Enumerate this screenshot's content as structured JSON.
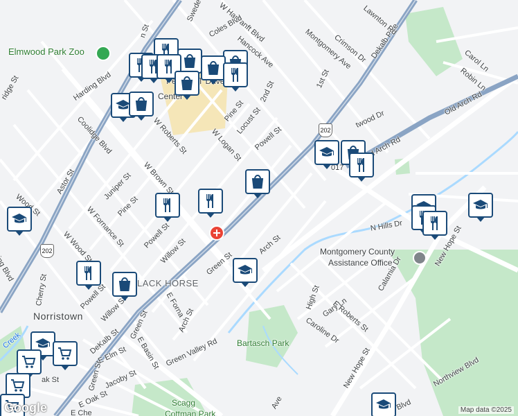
{
  "map": {
    "attribution": "Map data ©2025",
    "logo": "Google",
    "colors": {
      "background": "#f2f3f5",
      "park": "#c5e8c9",
      "water": "#aadaff",
      "highway": "#8aa4c4",
      "road": "#ffffff",
      "pin": "#1a4a78",
      "campus": "#f5e6b8"
    }
  },
  "labels": {
    "elmwood_zoo": "Elmwood Park Zoo",
    "penndot": "PennDOT Driver",
    "penndot2": "Center",
    "swede": "Swede Rd",
    "hartranft": "W Hartranft Blvd",
    "coles": "Coles Blvd",
    "hancock": "Hancock Ave",
    "montgomery_ave": "Montgomery Ave",
    "crimson": "Crimson Dr",
    "dekalb_pike": "Dekalb Pike",
    "lawnton": "Lawnton Rd",
    "carol": "Carol Ln",
    "robin": "Robin Ln",
    "old_arch": "Old Arch Rd",
    "old_arch2": "d Arch Rd",
    "first_st": "1st St",
    "second_st": "2nd St",
    "pine_st": "Pine St",
    "locust": "Locust St",
    "powell": "Powell St",
    "w_logan": "W Logan St",
    "w_roberts": "W Roberts St",
    "harding": "Harding Blvd",
    "coolidge": "Coolidge Blvd",
    "w_brown": "W Brown St",
    "astor": "Astor St",
    "juniper": "Juniper St",
    "pine2": "Pine St",
    "wood": "Wood St",
    "w_fornance": "W Fornance St",
    "powell2": "Powell St",
    "willow": "Willow St",
    "green": "Green St",
    "arch": "Arch St",
    "w_wood": "W Wood St",
    "black_horse": "LACK HORSE",
    "powell3": "Powell St",
    "willow2": "Willow St",
    "cherry": "Cherry St",
    "norristown": "Norristown",
    "dekalb": "DeKalb St",
    "e_fornance": "E Forna",
    "arch2": "Arch St",
    "green2": "Green St",
    "e_basin": "E Basin St",
    "green_valley": "Green Valley Rd",
    "e_elm": "E Elm St",
    "green3": "Green St",
    "jacoby": "Jacoby St",
    "e_oak": "E Oak St",
    "bartasch": "Bartasch Park",
    "montco1": "Montgomery County",
    "montco2": "Assistance Office",
    "n_hills": "N Hills Dr",
    "new_hope": "New Hope St",
    "new_hope2": "New Hope St",
    "calamia": "Calamia Dr",
    "high": "High St",
    "gary": "Gary Ln",
    "caroline": "Caroline Dr",
    "e_roberts": "E Roberts St",
    "northview": "Northview Blvd",
    "scagg": "Scagg",
    "cottman": "Cottman Park",
    "ridge": "ridge St",
    "ing_blvd": "ing Blvd",
    "ak_st": "ak St",
    "e_che": "E Che",
    "ave": "Ave",
    "wer": "wer Blvd",
    "n_st": "n St",
    "creek": "Creek",
    "twood": "twood Dr",
    "hwy202a": "202",
    "hwy202b": "202",
    "hwy202c": "202",
    "n017": "017"
  },
  "pins": [
    {
      "type": "restaurant"
    },
    {
      "type": "restaurant"
    },
    {
      "type": "shopping"
    },
    {
      "type": "restaurant"
    },
    {
      "type": "shopping"
    },
    {
      "type": "restaurant"
    },
    {
      "type": "shopping"
    },
    {
      "type": "school"
    },
    {
      "type": "shopping"
    },
    {
      "type": "shopping"
    },
    {
      "type": "restaurant"
    },
    {
      "type": "restaurant"
    },
    {
      "type": "school"
    },
    {
      "type": "shopping"
    },
    {
      "type": "restaurant"
    },
    {
      "type": "school"
    },
    {
      "type": "school"
    },
    {
      "type": "restaurant"
    },
    {
      "type": "restaurant"
    },
    {
      "type": "school"
    },
    {
      "type": "restaurant"
    },
    {
      "type": "restaurant"
    },
    {
      "type": "shopping"
    },
    {
      "type": "school"
    },
    {
      "type": "shopping"
    },
    {
      "type": "school"
    },
    {
      "type": "grocery"
    },
    {
      "type": "grocery"
    },
    {
      "type": "grocery"
    },
    {
      "type": "grocery"
    },
    {
      "type": "school"
    }
  ]
}
